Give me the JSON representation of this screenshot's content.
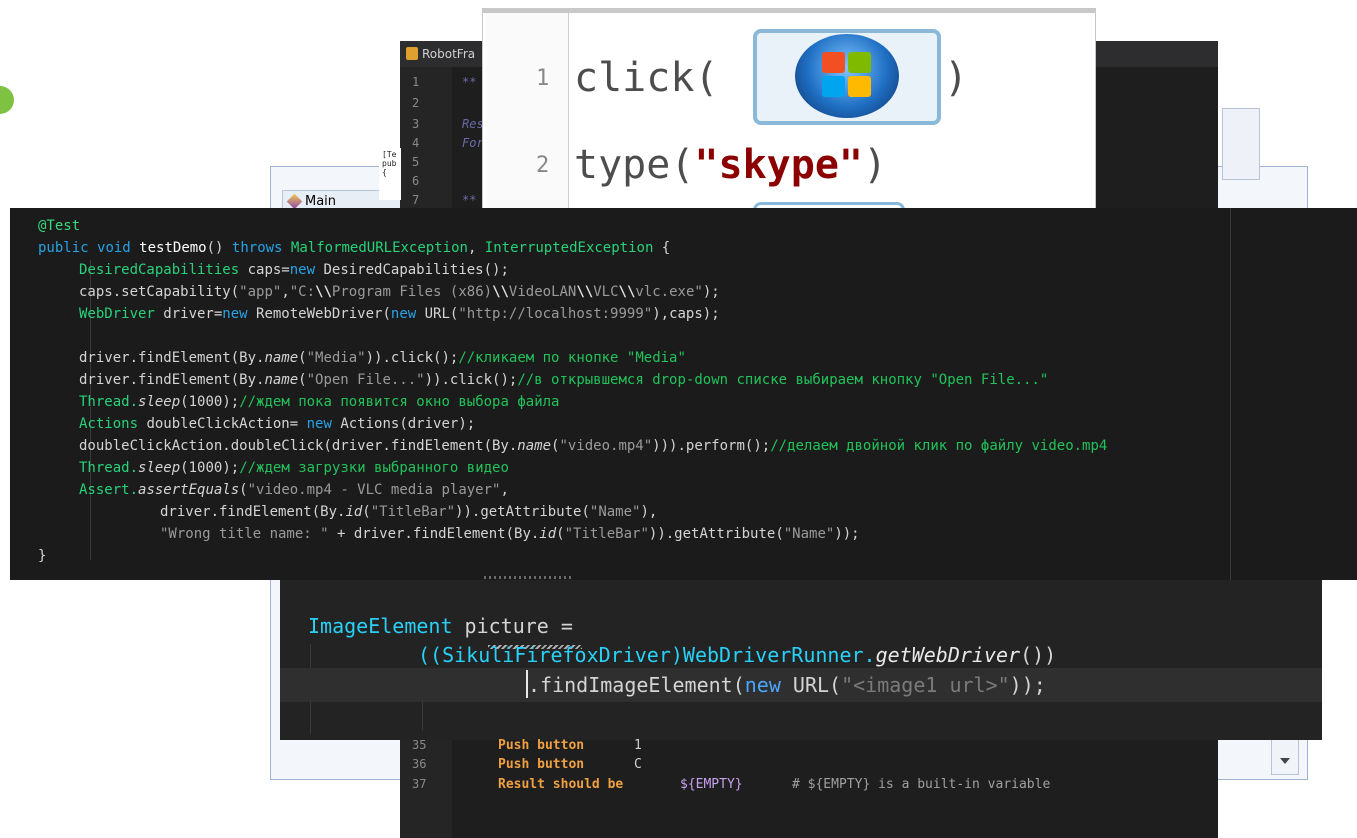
{
  "background_window": {
    "tab_label": "Main"
  },
  "robot_editor": {
    "title": "RobotFra",
    "line_numbers": [
      "1",
      "2",
      "3",
      "4",
      "5",
      "6",
      "7"
    ],
    "lines": [
      {
        "n": "1",
        "text": "**"
      },
      {
        "n": "3",
        "text": "Res"
      },
      {
        "n": "4",
        "text": "For"
      },
      {
        "n": "7",
        "text": "**"
      }
    ],
    "bottom_lines": [
      {
        "n": "35",
        "keyword": "Push button",
        "arg": "1"
      },
      {
        "n": "36",
        "keyword": "Push button",
        "arg": "C"
      },
      {
        "n": "37",
        "keyword": "Result should be",
        "arg": "${EMPTY}",
        "comment": "# ${EMPTY} is a built-in variable"
      }
    ]
  },
  "small_pane": {
    "lines": [
      "[Te",
      "pub",
      "{"
    ]
  },
  "sikuli_script": {
    "line1_num": "1",
    "line1_fn": "click(",
    "line1_close": ")",
    "line2_num": "2",
    "line2_fn": "type(",
    "line2_arg": "\"skype\"",
    "line2_close": ")",
    "image_icon": "windows-start-logo"
  },
  "java_test": {
    "annotation": "@Test",
    "signature": {
      "mod": "public",
      "ret": "void",
      "name": "testDemo",
      "params": "()",
      "throws": "throws",
      "exc1": "MalformedURLException",
      "comma": ", ",
      "exc2": "InterruptedException",
      "brace": " {"
    },
    "l3": {
      "type": "DesiredCapabilities",
      "rest": " caps=",
      "new": "new",
      "ctor": " DesiredCapabilities();"
    },
    "l4": {
      "pre": "caps.setCapability(",
      "s1": "\"app\"",
      "comma": ",",
      "s2a": "\"C:",
      "esc1": "\\\\",
      "s2b": "Program Files (x86)",
      "esc2": "\\\\",
      "s2c": "VideoLAN",
      "esc3": "\\\\",
      "s2d": "VLC",
      "esc4": "\\\\",
      "s2e": "vlc.exe\"",
      "post": ");"
    },
    "l5": {
      "type": "WebDriver",
      "rest": " driver=",
      "new1": "new",
      "mid": " RemoteWebDriver(",
      "new2": "new",
      "mid2": " URL(",
      "str": "\"http://localhost:9999\"",
      "post": "),caps);"
    },
    "l7": {
      "pre": "driver.findElement(By.",
      "it": "name",
      "open": "(",
      "str": "\"Media\"",
      "post": ")).click();",
      "comment": "//кликаем по кнопке \"Media\""
    },
    "l8": {
      "pre": "driver.findElement(By.",
      "it": "name",
      "open": "(",
      "str": "\"Open File...\"",
      "post": ")).click();",
      "comment": "//в открывшемся drop-down списке выбираем кнопку \"Open File...\""
    },
    "l9": {
      "type": "Thread.",
      "it": "sleep",
      "post": "(1000);",
      "comment": "//ждем пока появится окно выбора файла"
    },
    "l10": {
      "type": "Actions",
      "rest": " doubleClickAction= ",
      "new": "new",
      "post": " Actions(driver);"
    },
    "l11": {
      "pre": "doubleClickAction.doubleClick(driver.findElement(By.",
      "it": "name",
      "open": "(",
      "str": "\"video.mp4\"",
      "post": "))).perform();",
      "comment": "//делаем двойной клик по файлу video.mp4"
    },
    "l12": {
      "type": "Thread.",
      "it": "sleep",
      "post": "(1000);",
      "comment": "//ждем загрузки выбранного видео"
    },
    "l13": {
      "type": "Assert.",
      "it": "assertEquals",
      "open": "(",
      "str": "\"video.mp4 - VLC media player\"",
      "post": ","
    },
    "l14": {
      "pre": "driver.findElement(By.",
      "it": "id",
      "open": "(",
      "str": "\"TitleBar\"",
      "post": ")).getAttribute(",
      "str2": "\"Name\"",
      "post2": "),"
    },
    "l15": {
      "str": "\"Wrong title name: \"",
      "pre": " + driver.findElement(By.",
      "it": "id",
      "open": "(",
      "str2": "\"TitleBar\"",
      "post": ")).getAttribute(",
      "str3": "\"Name\"",
      "post2": "));"
    },
    "l16": "}"
  },
  "java_image": {
    "l1_type": "ImageElement",
    "l1_var": "picture",
    "l1_eq": " =",
    "l2_open": "((",
    "l2_type": "SikuliFirefoxDriver",
    "l2_close": ")WebDriverRunner.",
    "l2_it": "getWebDriver",
    "l2_end": "())",
    "l3_pre": ".findImageElement(",
    "l3_new": "new",
    "l3_mid": " URL(",
    "l3_str": "\"<image1 url>\"",
    "l3_end": "));"
  }
}
